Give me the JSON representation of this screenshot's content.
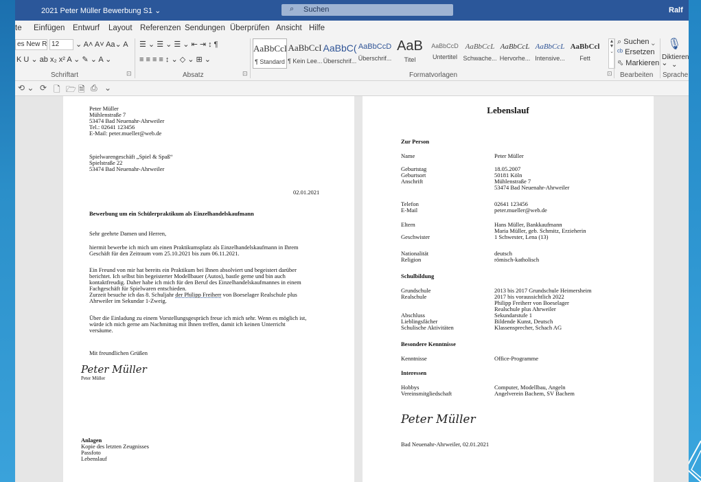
{
  "window": {
    "doc_title": "2021 Peter Müller Bewerbung S1",
    "title_chevron": "⌄",
    "search_placeholder": "Suchen",
    "user": "Ralf"
  },
  "tabs": [
    "te",
    "Einfügen",
    "Entwurf",
    "Layout",
    "Referenzen",
    "Sendungen",
    "Überprüfen",
    "Ansicht",
    "Hilfe"
  ],
  "ribbon": {
    "font_name": "es New R",
    "font_size": "12",
    "groups": {
      "schriftart": "Schriftart",
      "absatz": "Absatz",
      "formatvorlagen": "Formatvorlagen",
      "bearbeiten": "Bearbeiten",
      "sprache": "Sprache"
    },
    "font_row1": "⌄ A˄ A˅  Aa⌄  A",
    "font_row2": "K  U ⌄  ab  x₂  x²   A ⌄  ✎ ⌄  A ⌄",
    "para_row1": "☰ ⌄ ☰ ⌄ ☰ ⌄   ⇤  ⇥   ↕  ¶",
    "para_row2": "≡  ≡  ≡  ≡   ↕ ⌄   ◇ ⌄  ⊞ ⌄",
    "styles": [
      {
        "preview": "AaBbCcI",
        "name": "¶ Standard"
      },
      {
        "preview": "AaBbCcI",
        "name": "¶ Kein Lee..."
      },
      {
        "preview": "AaBbC(",
        "name": "Überschrif..."
      },
      {
        "preview": "AaBbCcD",
        "name": "Überschrif..."
      },
      {
        "preview": "AaB",
        "name": "Titel"
      },
      {
        "preview": "AaBbCcD",
        "name": "Untertitel"
      },
      {
        "preview": "AaBbCcL",
        "name": "Schwache..."
      },
      {
        "preview": "AaBbCcL",
        "name": "Hervorhe..."
      },
      {
        "preview": "AaBbCcL",
        "name": "Intensive..."
      },
      {
        "preview": "AaBbCcl",
        "name": "Fett"
      }
    ],
    "suchen": "Suchen",
    "ersetzen": "Ersetzen",
    "markieren": "Markieren",
    "diktieren": "Diktieren",
    "expand_mark": "⌄",
    "launcher": "⊡",
    "mic_glyph": "🎙"
  },
  "qat": [
    "⟲ ⌄",
    "⟳",
    "🗋",
    "🗁",
    "🗎",
    "⎙",
    "⌄"
  ],
  "letter": {
    "sender": [
      "Peter Müller",
      "Mühlenstraße 7",
      "53474 Bad Neuenahr-Ahrweiler",
      "Tel.: 02641 123456",
      "E-Mail: peter.mueller@web.de"
    ],
    "recipient": [
      "Spielwarengeschäft „Spiel & Spaß“",
      "Spielstraße 22",
      "53474 Bad Neuenahr-Ahrweiler"
    ],
    "date": "02.01.2021",
    "subject": "Bewerbung um ein Schülerpraktikum als Einzelhandelskaufmann",
    "salutation": "Sehr geehrte Damen und Herren,",
    "p1": [
      "hiermit bewerbe ich mich um einen Praktikumsplatz als Einzelhandelskaufmann in Ihrem",
      "Geschäft für den Zeitraum vom 25.10.2021 bis zum 06.11.2021."
    ],
    "p2": [
      "Ein Freund von mir hat bereits ein Praktikum bei Ihnen absolviert und begeistert darüber",
      "berichtet. Ich selbst bin begeisterter Modellbauer (Autos), bastle gerne und bin auch",
      "kontaktfreudig. Daher habe ich mich für den Beruf des Einzelhandelskaufmannes in einem",
      "Fachgeschäft für Spielwaren entschieden."
    ],
    "p3a": "Zurzeit besuche ich das 8. Schuljahr ",
    "p3b": "der Philipp Freiherr",
    "p3c": " von Boeselager Realschule plus",
    "p3d": "Ahrweiler im Sekundar 1-Zweig.",
    "p4": [
      "Über die Einladung zu einem Vorstellungsgespräch freue ich mich sehr. Wenn es möglich ist,",
      "würde ich mich gerne am Nachmittag mit Ihnen treffen, damit ich keinen Unterricht",
      "versäume."
    ],
    "closing": "Mit freundlichen Grüßen",
    "signature": "Peter Müller",
    "name": "Peter Müller",
    "attachments_title": "Anlagen",
    "attachments": [
      "Kopie des letzten Zeugnisses",
      "Passfoto",
      "Lebenslauf"
    ]
  },
  "cv": {
    "title": "Lebenslauf",
    "sections": {
      "person": "Zur Person",
      "school": "Schulbildung",
      "skills": "Besondere Kenntnisse",
      "interests": "Interessen"
    },
    "rows": [
      {
        "label": "Name",
        "value": "Peter Müller"
      },
      {
        "label": "Geburtstag",
        "value": "18.05.2007"
      },
      {
        "label": "Geburtsort",
        "value": "50181 Köln"
      },
      {
        "label": "Anschrift",
        "value": "Mühlenstraße 7"
      },
      {
        "label": "",
        "value": "53474 Bad Neuenahr-Ahrweiler"
      },
      {
        "label": "Telefon",
        "value": "02641 123456"
      },
      {
        "label": "E-Mail",
        "value": "peter.mueller@web.de"
      },
      {
        "label": "Eltern",
        "value": "Hans Müller, Bankkaufmann"
      },
      {
        "label": "",
        "value": "Maria Müller, geb. Schmitz, Erzieherin"
      },
      {
        "label": "Geschwister",
        "value": "1 Schwester, Lena (13)"
      },
      {
        "label": "Nationalität",
        "value": "deutsch"
      },
      {
        "label": "Religion",
        "value": "römisch-katholisch"
      },
      {
        "label": "Grundschule",
        "value": "2013 bis 2017 Grundschule Heimersheim"
      },
      {
        "label": "Realschule",
        "value": "2017 bis voraussichtlich 2022"
      },
      {
        "label": "",
        "value": "Philipp Freiherr von Boeselager"
      },
      {
        "label": "",
        "value": "Realschule plus Ahrweiler"
      },
      {
        "label": "Abschluss",
        "value": "Sekundarstufe 1"
      },
      {
        "label": "Lieblingsfächer",
        "value": "Bildende Kunst, Deutsch"
      },
      {
        "label": "Schulische Aktivitäten",
        "value": "Klassensprecher, Schach AG"
      },
      {
        "label": "Kenntnisse",
        "value": "Office-Programme"
      },
      {
        "label": "Hobbys",
        "value": "Computer, Modellbau, Angeln"
      },
      {
        "label": "Vereinsmitgliedschaft",
        "value": "Angelverein Bachem, SV Bachem"
      }
    ],
    "signature": "Peter Müller",
    "place_date": "Bad Neuenahr-Ahrweiler, 02.01.2021"
  }
}
